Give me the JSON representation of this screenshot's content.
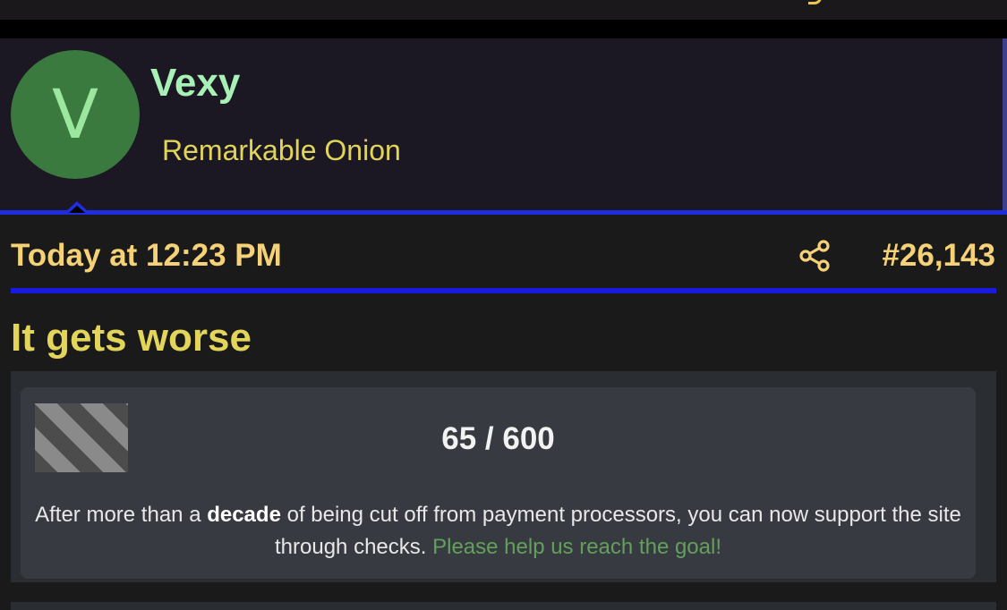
{
  "user": {
    "avatar_letter": "V",
    "avatar_color": "#3a7a3e",
    "username": "Vexy",
    "title": "Remarkable Onion"
  },
  "post": {
    "date": "Today at 12:23 PM",
    "share_icon": "share-icon",
    "number": "#26,143",
    "title": "It gets worse"
  },
  "notice": {
    "progress": "65 / 600",
    "progress_current": 65,
    "progress_goal": 600,
    "text_before": "After more than a ",
    "text_bold": "decade",
    "text_after": " of being cut off from payment processors, you can now support the site through checks. ",
    "link_text": "Please help us reach the goal!"
  },
  "colors": {
    "accent_blue": "#1f2ce0",
    "date_yellow": "#f5d278",
    "username_green": "#a8f0b6",
    "link_green": "#63a05c"
  }
}
